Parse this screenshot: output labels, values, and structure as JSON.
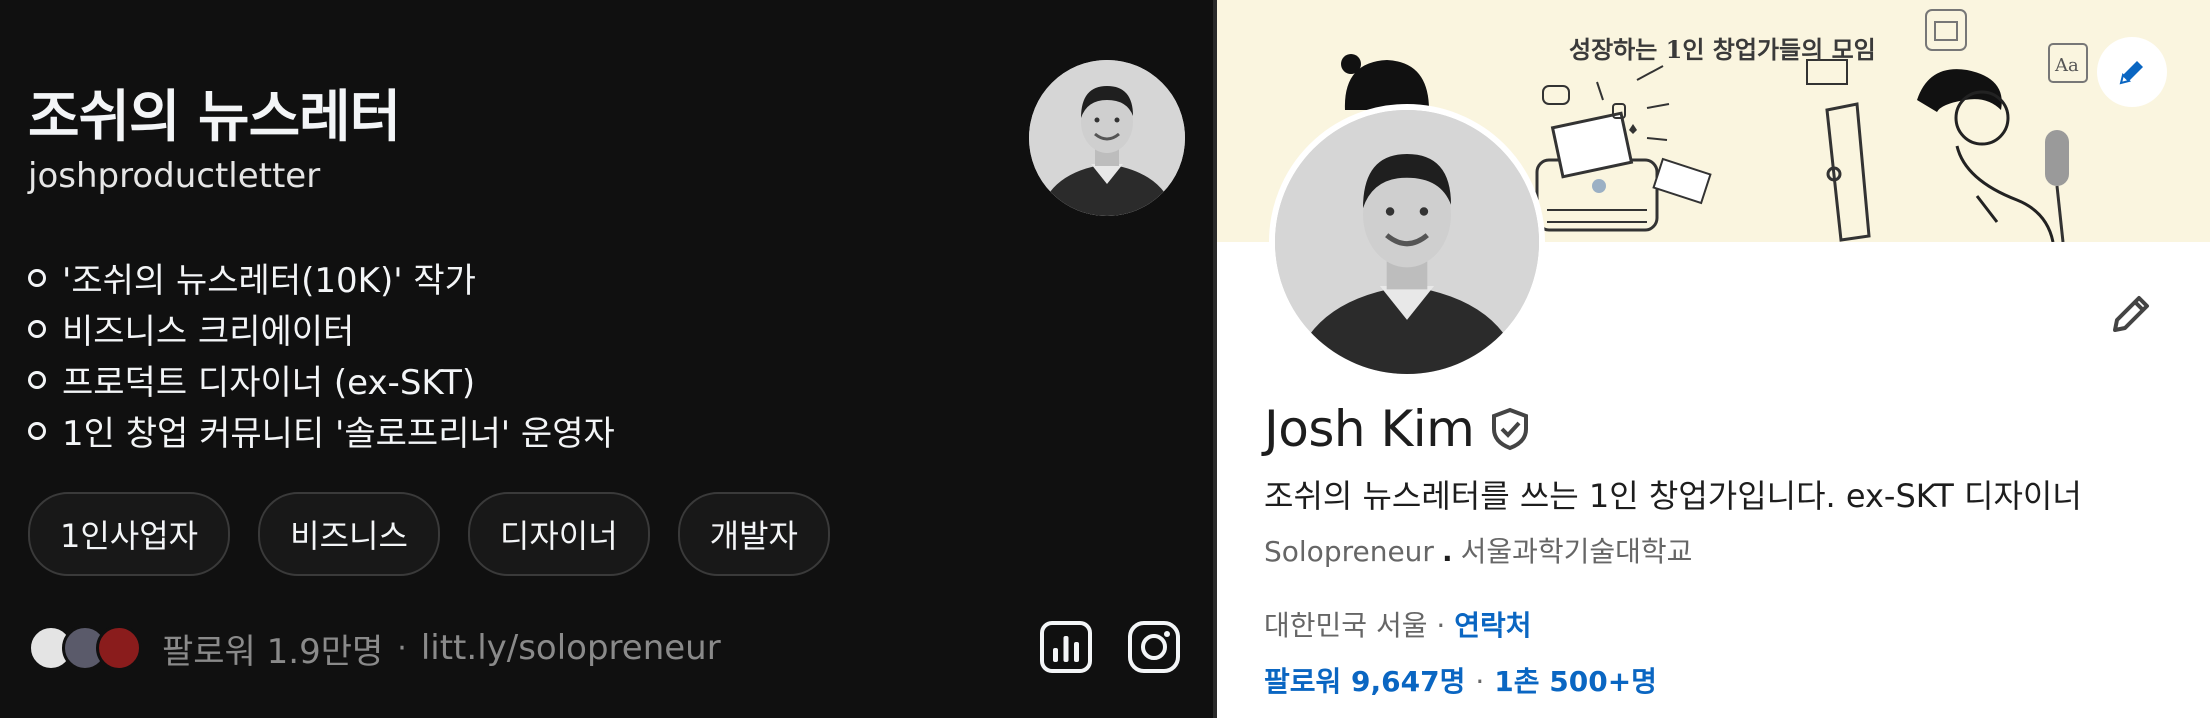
{
  "threads_profile": {
    "title": "조쉬의 뉴스레터",
    "handle": "joshproductletter",
    "bio": [
      "'조쉬의 뉴스레터(10K)' 작가",
      "비즈니스 크리에이터",
      "프로덕트 디자이너 (ex-SKT)",
      "1인 창업 커뮤니티 '솔로프리너' 운영자"
    ],
    "tags": [
      "1인사업자",
      "비즈니스",
      "디자이너",
      "개발자"
    ],
    "followers": "팔로워 1.9만명",
    "separator": "·",
    "link": "litt.ly/solopreneur",
    "icons": [
      "insights-icon",
      "instagram-icon"
    ],
    "avatar": "profile-photo",
    "colors": {
      "background": "#101010",
      "text": "#f3f5f7",
      "muted": "#8a8a8a"
    }
  },
  "linkedin_profile": {
    "banner_text": "성장하는 1인 창업가들의 모임",
    "name": "Josh Kim",
    "headline": "조쉬의 뉴스레터를 쓰는 1인 창업가입니다. ex-SKT 디자이너",
    "role": "Solopreneur",
    "role_separator": ".",
    "school": "서울과학기술대학교",
    "location": "대한민국 서울",
    "location_separator": "·",
    "contact_label": "연락처",
    "followers": "팔로워 9,647명",
    "stats_separator": "·",
    "connections": "1촌 500+명",
    "icons": [
      "pencil-icon",
      "verified-shield-icon"
    ],
    "colors": {
      "link": "#0a66c2",
      "banner": "#faf5df",
      "text": "#1d1d1d",
      "muted": "#666666"
    }
  }
}
